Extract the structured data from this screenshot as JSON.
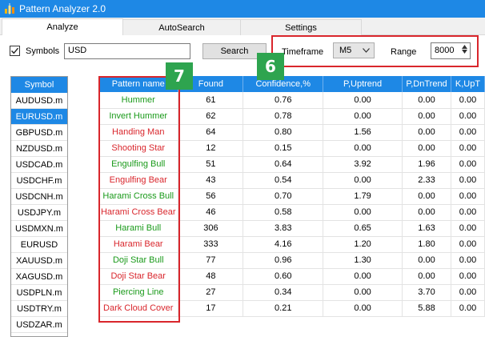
{
  "window": {
    "title": "Pattern Analyzer 2.0"
  },
  "tabs": [
    {
      "label": "Analyze",
      "active": true
    },
    {
      "label": "AutoSearch",
      "active": false
    },
    {
      "label": "Settings",
      "active": false
    }
  ],
  "toolbar": {
    "symbols_label": "Symbols",
    "symbols_checked": true,
    "symbols_value": "USD",
    "search_label": "Search",
    "timeframe_label": "Timeframe",
    "timeframe_value": "M5",
    "range_label": "Range",
    "range_value": "8000"
  },
  "badges": {
    "timeframe_badge": "6",
    "pattern_badge": "7"
  },
  "symbol_list": {
    "header": "Symbol",
    "selected_index": 1,
    "items": [
      "AUDUSD.m",
      "EURUSD.m",
      "GBPUSD.m",
      "NZDUSD.m",
      "USDCAD.m",
      "USDCHF.m",
      "USDCNH.m",
      "USDJPY.m",
      "USDMXN.m",
      "EURUSD",
      "XAUUSD.m",
      "XAGUSD.m",
      "USDPLN.m",
      "USDTRY.m",
      "USDZAR.m"
    ]
  },
  "grid": {
    "columns": [
      "Pattern name",
      "Found",
      "Confidence,%",
      "P,Uptrend",
      "P,DnTrend",
      "K,UpT"
    ],
    "rows": [
      {
        "name": "Hummer",
        "kind": "bull",
        "found": "61",
        "confidence": "0.76",
        "p_up": "0.00",
        "p_dn": "0.00",
        "k_up": "0.00"
      },
      {
        "name": "Invert Hummer",
        "kind": "bull",
        "found": "62",
        "confidence": "0.78",
        "p_up": "0.00",
        "p_dn": "0.00",
        "k_up": "0.00"
      },
      {
        "name": "Handing Man",
        "kind": "bear",
        "found": "64",
        "confidence": "0.80",
        "p_up": "1.56",
        "p_dn": "0.00",
        "k_up": "0.00"
      },
      {
        "name": "Shooting Star",
        "kind": "bear",
        "found": "12",
        "confidence": "0.15",
        "p_up": "0.00",
        "p_dn": "0.00",
        "k_up": "0.00"
      },
      {
        "name": "Engulfing Bull",
        "kind": "bull",
        "found": "51",
        "confidence": "0.64",
        "p_up": "3.92",
        "p_dn": "1.96",
        "k_up": "0.00"
      },
      {
        "name": "Engulfing Bear",
        "kind": "bear",
        "found": "43",
        "confidence": "0.54",
        "p_up": "0.00",
        "p_dn": "2.33",
        "k_up": "0.00"
      },
      {
        "name": "Harami Cross Bull",
        "kind": "bull",
        "found": "56",
        "confidence": "0.70",
        "p_up": "1.79",
        "p_dn": "0.00",
        "k_up": "0.00"
      },
      {
        "name": "Harami Cross Bear",
        "kind": "bear",
        "found": "46",
        "confidence": "0.58",
        "p_up": "0.00",
        "p_dn": "0.00",
        "k_up": "0.00"
      },
      {
        "name": "Harami Bull",
        "kind": "bull",
        "found": "306",
        "confidence": "3.83",
        "p_up": "0.65",
        "p_dn": "1.63",
        "k_up": "0.00"
      },
      {
        "name": "Harami Bear",
        "kind": "bear",
        "found": "333",
        "confidence": "4.16",
        "p_up": "1.20",
        "p_dn": "1.80",
        "k_up": "0.00"
      },
      {
        "name": "Doji Star Bull",
        "kind": "bull",
        "found": "77",
        "confidence": "0.96",
        "p_up": "1.30",
        "p_dn": "0.00",
        "k_up": "0.00"
      },
      {
        "name": "Doji Star Bear",
        "kind": "bear",
        "found": "48",
        "confidence": "0.60",
        "p_up": "0.00",
        "p_dn": "0.00",
        "k_up": "0.00"
      },
      {
        "name": "Piercing Line",
        "kind": "bull",
        "found": "27",
        "confidence": "0.34",
        "p_up": "0.00",
        "p_dn": "3.70",
        "k_up": "0.00"
      },
      {
        "name": "Dark Cloud Cover",
        "kind": "bear",
        "found": "17",
        "confidence": "0.21",
        "p_up": "0.00",
        "p_dn": "5.88",
        "k_up": "0.00"
      }
    ]
  },
  "colors": {
    "accent": "#1e88e5",
    "bull": "#1a9a1a",
    "bear": "#d9262c",
    "highlight": "#d9262c",
    "badge": "#2ea44f"
  }
}
